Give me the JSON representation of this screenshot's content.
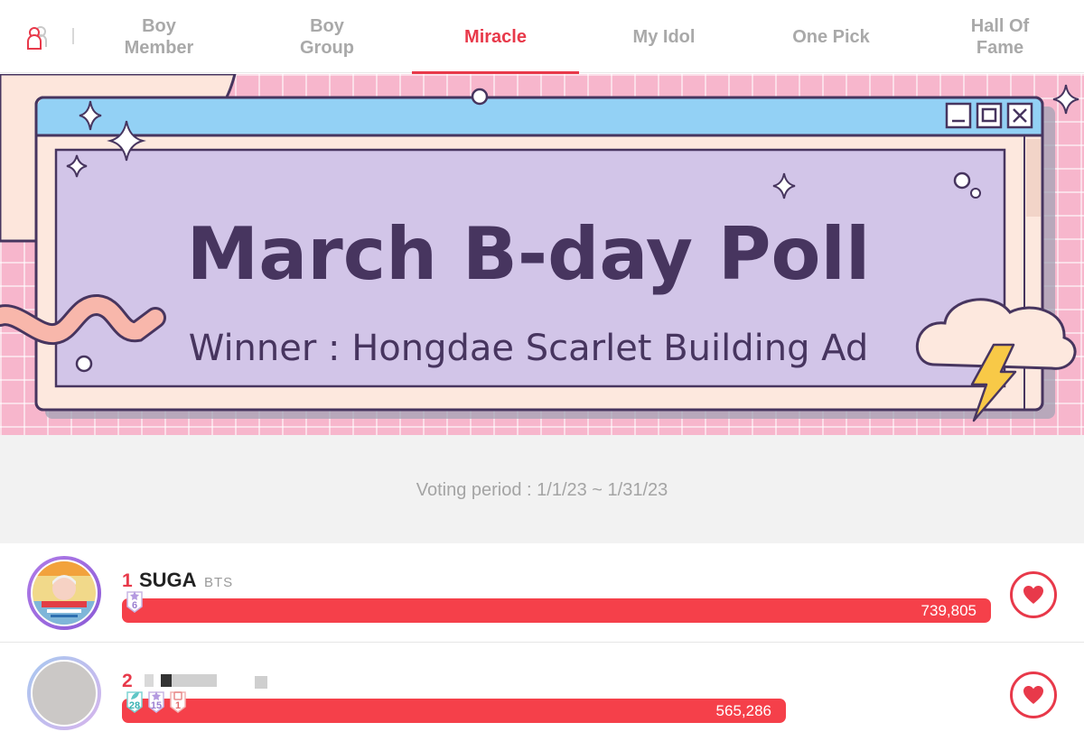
{
  "nav": {
    "tabs": [
      {
        "label": "Boy\nMember",
        "active": false
      },
      {
        "label": "Boy\nGroup",
        "active": false
      },
      {
        "label": "Miracle",
        "active": true
      },
      {
        "label": "My Idol",
        "active": false
      },
      {
        "label": "One Pick",
        "active": false
      },
      {
        "label": "Hall Of\nFame",
        "active": false
      }
    ]
  },
  "banner": {
    "title": "March B-day Poll",
    "subtitle": "Winner : Hongdae Scarlet Building Ad"
  },
  "voting_period": "Voting period : 1/1/23 ~ 1/31/23",
  "ranking": [
    {
      "rank": "1",
      "name": "SUGA",
      "group": "BTS",
      "votes": "739,805",
      "vote_fraction": 1.0,
      "badges": [
        {
          "icon": "star-badge-icon",
          "value": "6"
        }
      ]
    },
    {
      "rank": "2",
      "name": "",
      "group": "",
      "votes": "565,286",
      "vote_fraction": 0.764,
      "badges": [
        {
          "icon": "leaf-badge-icon",
          "value": "28"
        },
        {
          "icon": "star-badge-icon",
          "value": "15"
        },
        {
          "icon": "ticket-badge-icon",
          "value": "1"
        }
      ]
    }
  ],
  "colors": {
    "accent": "#e8394a",
    "bar": "#f5404a",
    "banner_pink": "#f7b6cc",
    "banner_window": "#d2c5e8",
    "banner_text": "#47355f"
  }
}
